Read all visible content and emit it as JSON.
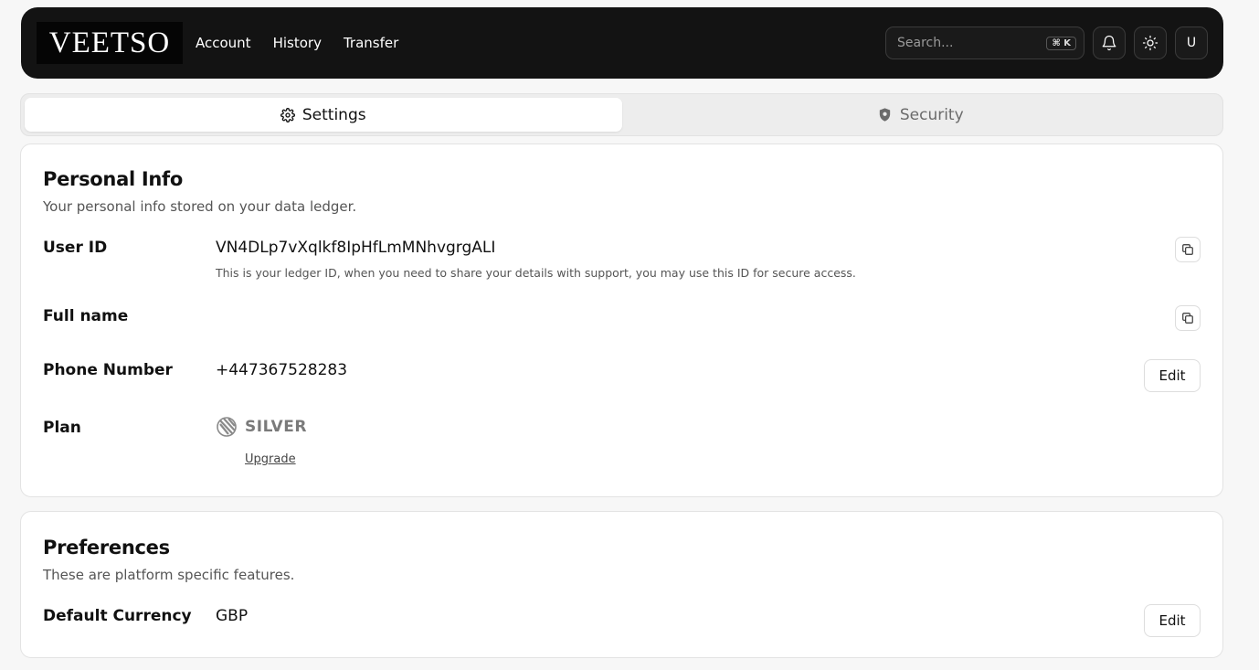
{
  "header": {
    "logo_text": "VEETSO",
    "nav": [
      "Account",
      "History",
      "Transfer"
    ],
    "search": {
      "placeholder": "Search...",
      "shortcut": "⌘ K"
    },
    "avatar_initial": "U"
  },
  "tabs": [
    {
      "label": "Settings",
      "icon": "gear-icon",
      "active": true
    },
    {
      "label": "Security",
      "icon": "shield-icon",
      "active": false
    }
  ],
  "personal_info": {
    "title": "Personal Info",
    "subtitle": "Your personal info stored on your data ledger.",
    "user_id": {
      "label": "User ID",
      "value": "VN4DLp7vXqlkf8IpHfLmMNhvgrgALI",
      "hint": "This is your ledger ID, when you need to share your details with support, you may use this ID for secure access."
    },
    "full_name": {
      "label": "Full name",
      "value": ""
    },
    "phone": {
      "label": "Phone Number",
      "value": "+447367528283",
      "edit_label": "Edit"
    },
    "plan": {
      "label": "Plan",
      "value": "SILVER",
      "upgrade_label": "Upgrade"
    }
  },
  "preferences": {
    "title": "Preferences",
    "subtitle": "These are platform specific features.",
    "currency": {
      "label": "Default Currency",
      "value": "GBP",
      "edit_label": "Edit"
    }
  }
}
